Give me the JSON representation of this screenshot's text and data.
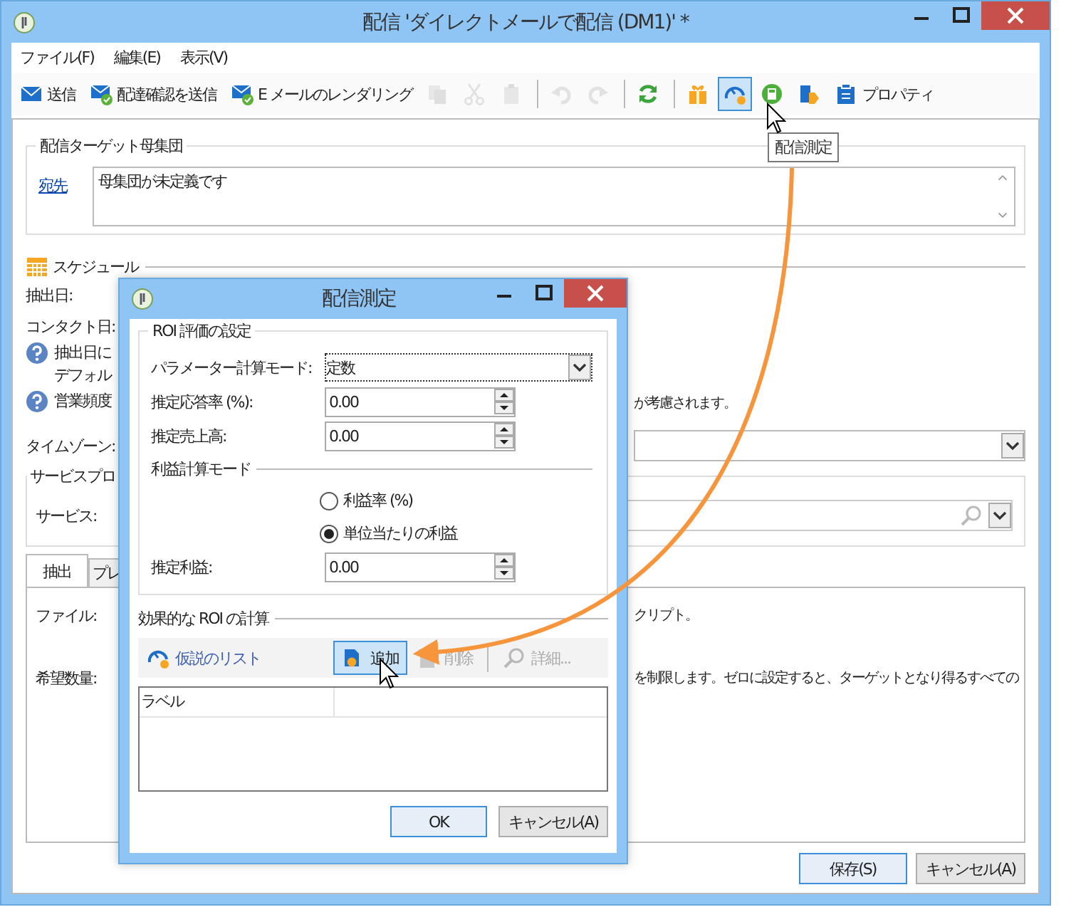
{
  "window": {
    "title": "配信 'ダイレクトメールで配信 (DM1)' *"
  },
  "menu": [
    "ファイル(F)",
    "編集(E)",
    "表示(V)"
  ],
  "toolbar": [
    {
      "kind": "labeled",
      "label": "送信",
      "disabled": false,
      "hovered": false
    },
    {
      "kind": "labeled",
      "label": "配達確認を送信",
      "disabled": false,
      "hovered": false
    },
    {
      "kind": "labeled",
      "label": "E メールのレンダリング",
      "disabled": false,
      "hovered": false
    },
    {
      "kind": "icon",
      "disabled": true,
      "hovered": false
    },
    {
      "kind": "icon",
      "disabled": true,
      "hovered": false
    },
    {
      "kind": "icon",
      "disabled": true,
      "hovered": false
    },
    {
      "kind": "separator"
    },
    {
      "kind": "icon",
      "disabled": true,
      "hovered": false
    },
    {
      "kind": "icon",
      "disabled": true,
      "hovered": false
    },
    {
      "kind": "separator"
    },
    {
      "kind": "icon",
      "disabled": false,
      "hovered": false
    },
    {
      "kind": "separator"
    },
    {
      "kind": "icon",
      "disabled": false,
      "hovered": false
    },
    {
      "kind": "icon",
      "disabled": false,
      "hovered": true
    },
    {
      "kind": "icon",
      "disabled": false,
      "hovered": false
    },
    {
      "kind": "icon",
      "disabled": false,
      "hovered": false
    },
    {
      "kind": "labeled",
      "label": "プロパティ",
      "disabled": false,
      "hovered": false
    }
  ],
  "tooltip": "配信測定",
  "target_group": {
    "title": "配信ターゲット母集団",
    "link": "宛先",
    "value": "母集団が未定義です"
  },
  "schedule": {
    "title": "スケジュール",
    "rows": [
      {
        "kind": "label",
        "text": "抽出日:"
      },
      {
        "kind": "label",
        "text": "コンタクト日:"
      },
      {
        "kind": "help",
        "lines": [
          "抽出日に",
          "デフォル"
        ],
        "tail": ""
      },
      {
        "kind": "help",
        "lines": [
          "営業頻度"
        ],
        "tail": "が考慮されます。"
      }
    ]
  },
  "timezone": {
    "label": "タイムゾーン:"
  },
  "service_group": {
    "title": "サービスプロ",
    "label": "サービス:"
  },
  "tabs": [
    {
      "label": "抽出",
      "selected": true
    },
    {
      "label": "プレ",
      "selected": false
    }
  ],
  "panel_rows": [
    {
      "label": "ファイル:",
      "tail": "クリプト。"
    },
    {
      "label": "希望数量:",
      "tail": "を制限します。ゼロに設定すると、ターゲットとなり得るすべての"
    }
  ],
  "buttons": [
    {
      "label": "保存(S)",
      "default": true
    },
    {
      "label": "キャンセル(A)",
      "default": false
    }
  ],
  "dialog": {
    "title": "配信測定",
    "settings_title": "ROI 評価の設定",
    "mode_label": "パラメーター計算モード:",
    "mode_value": "定数",
    "fields": [
      {
        "label": "推定応答率 (%):",
        "value": "0.00"
      },
      {
        "label": "推定売上高:",
        "value": "0.00"
      }
    ],
    "profit_mode_title": "利益計算モード",
    "profit_options": [
      {
        "label": "利益率 (%)",
        "selected": false
      },
      {
        "label": "単位当たりの利益",
        "selected": true
      }
    ],
    "profit_field": {
      "label": "推定利益:",
      "value": "0.00"
    },
    "roi_title": "効果的な ROI の計算",
    "roi_toolbar": [
      {
        "label": "仮説のリスト",
        "disabled": false,
        "hovered": false
      },
      {
        "label": "追加",
        "disabled": false,
        "hovered": true
      },
      {
        "label": "削除",
        "disabled": true,
        "hovered": false
      },
      {
        "label": "詳細...",
        "disabled": true,
        "hovered": false
      }
    ],
    "columns": [
      "ラベル"
    ],
    "buttons": [
      {
        "label": "OK",
        "default": true
      },
      {
        "label": "キャンセル(A)",
        "default": false
      }
    ]
  }
}
